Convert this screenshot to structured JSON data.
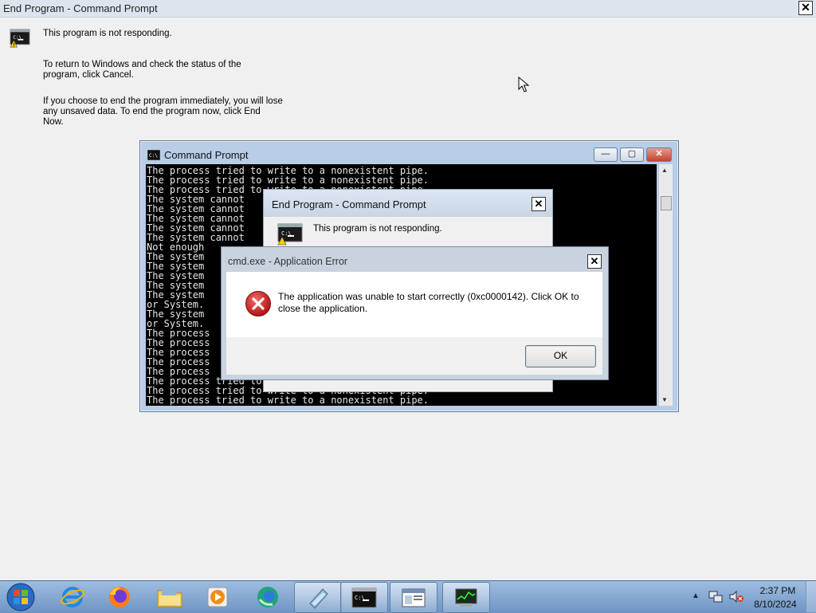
{
  "top_window": {
    "title": "End Program - Command Prompt",
    "close_glyph": "✕",
    "icon": "console-warning-icon",
    "message": "This program is not responding.",
    "para1_line1": "To return to Windows and check the status of the",
    "para1_line2": "program, click Cancel.",
    "para2_line1": "If you choose to end the program immediately, you will lose",
    "para2_line2": "any unsaved data. To end the program now, click End",
    "para2_line3": "Now."
  },
  "cmd_window": {
    "title": "Command Prompt",
    "minimize_glyph": "—",
    "maximize_glyph": "▢",
    "close_glyph": "✕",
    "lines": [
      "The process tried to write to a nonexistent pipe.",
      "The process tried to write to a nonexistent pipe.",
      "The process tried to write to a nonexistent pipe.",
      "The system cannot",
      "The system cannot",
      "The system cannot",
      "The system cannot",
      "The system cannot",
      "Not enough",
      "The system",
      "The system",
      "The system",
      "The system",
      "The system                                            e file f",
      "or System.",
      "The system                                            e file f",
      "or System.",
      "The process",
      "The process",
      "The process",
      "The process",
      "The process",
      "The process tried to write to a nonexistent pipe.",
      "The process tried to write to a nonexistent pipe.",
      "The process tried to write to a nonexistent pipe."
    ]
  },
  "end_program_dialog": {
    "title": "End Program - Command Prompt",
    "close_glyph": "✕",
    "message": "This program is not responding."
  },
  "error_dialog": {
    "title": "cmd.exe - Application Error",
    "close_glyph": "✕",
    "message_line1": "The application was unable to start correctly (0xc0000142). Click OK to",
    "message_line2": "close the application.",
    "ok_label": "OK",
    "icon": "error-x-icon"
  },
  "taskbar": {
    "items": [
      "start-orb",
      "internet-explorer",
      "firefox",
      "file-explorer",
      "media-player",
      "edge",
      "app-window",
      "command-prompt",
      "dialog-window",
      "task-manager"
    ],
    "clock_time": "2:37 PM",
    "clock_date": "8/10/2024",
    "tray_chevron": "▲"
  }
}
